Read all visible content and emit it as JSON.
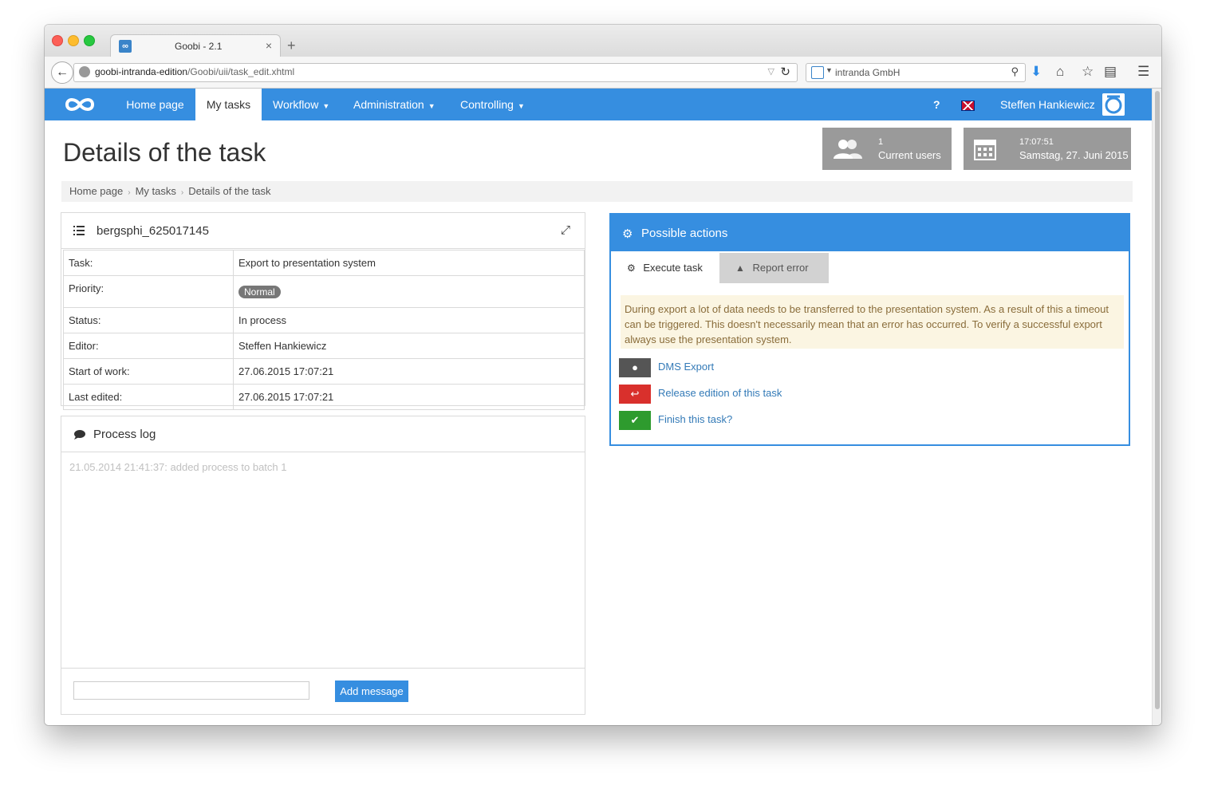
{
  "browser": {
    "tab_title": "Goobi - 2.1",
    "tab_favicon": "∞",
    "url_host": "goobi-intranda-edition",
    "url_path": "/Goobi/uii/task_edit.xhtml",
    "search_engine": "intranda GmbH",
    "new_tab": "+"
  },
  "nav": {
    "items": [
      {
        "label": "Home page",
        "active": false
      },
      {
        "label": "My tasks",
        "active": true
      },
      {
        "label": "Workflow",
        "dropdown": true
      },
      {
        "label": "Administration",
        "dropdown": true
      },
      {
        "label": "Controlling",
        "dropdown": true
      }
    ],
    "help": "?",
    "user": "Steffen Hankiewicz"
  },
  "header": {
    "title": "Details of the task",
    "users_widget": {
      "count": "1",
      "label": "Current users"
    },
    "clock_widget": {
      "time": "17:07:51",
      "date": "Samstag, 27. Juni 2015"
    }
  },
  "breadcrumb": [
    "Home page",
    "My tasks",
    "Details of the task"
  ],
  "task_panel": {
    "title": "bergsphi_625017145",
    "rows": [
      {
        "label": "Task:",
        "value": "Export to presentation system"
      },
      {
        "label": "Priority:",
        "value": "Normal"
      },
      {
        "label": "Status:",
        "value": "In process"
      },
      {
        "label": "Editor:",
        "value": "Steffen Hankiewicz"
      },
      {
        "label": "Start of work:",
        "value": "27.06.2015 17:07:21"
      },
      {
        "label": "Last edited:",
        "value": "27.06.2015 17:07:21"
      }
    ]
  },
  "process_log": {
    "title": "Process log",
    "entries": [
      "21.05.2014 21:41:37: added process to batch 1"
    ],
    "input_placeholder": "",
    "add_button": "Add message"
  },
  "actions_panel": {
    "title": "Possible actions",
    "tabs": [
      "Execute task",
      "Report error"
    ],
    "warning": "During export a lot of data needs to be transferred to the presentation system. As a result of this a timeout can be triggered. This doesn't necessarily mean that an error has occurred. To verify a successful export always use the presentation system.",
    "actions": [
      {
        "label": "DMS Export",
        "icon": "globe-icon",
        "color": "#555555"
      },
      {
        "label": "Release edition of this task",
        "icon": "reply-icon",
        "color": "#d9302c"
      },
      {
        "label": "Finish this task?",
        "icon": "check-icon",
        "color": "#2e9b2e"
      }
    ]
  },
  "colors": {
    "accent": "#368ee0",
    "widget": "#9a9a9a"
  }
}
